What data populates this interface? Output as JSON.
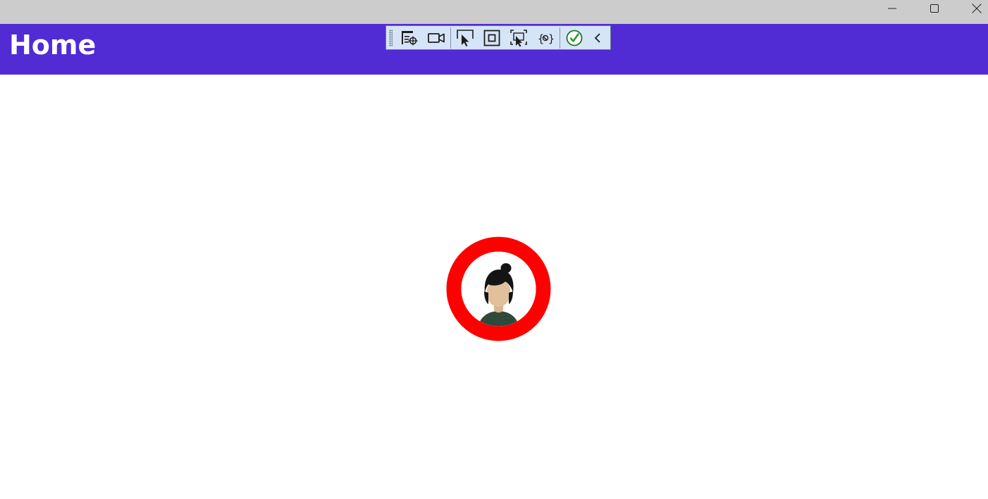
{
  "window": {
    "controls": {
      "minimize_icon": "minimize-icon",
      "maximize_icon": "maximize-icon",
      "close_icon": "close-icon"
    }
  },
  "header": {
    "title": "Home",
    "background": "#512bd4"
  },
  "debug_toolbar": {
    "tools": [
      "live-visual-tree-icon",
      "record-icon",
      "select-element-icon",
      "display-layout-adorners-icon",
      "track-focused-element-icon",
      "binding-failures-icon",
      "hot-reload-status-icon",
      "collapse-chevron-icon"
    ]
  },
  "avatar": {
    "ring_color": "#ff0000",
    "icon": "person-avatar-icon"
  }
}
